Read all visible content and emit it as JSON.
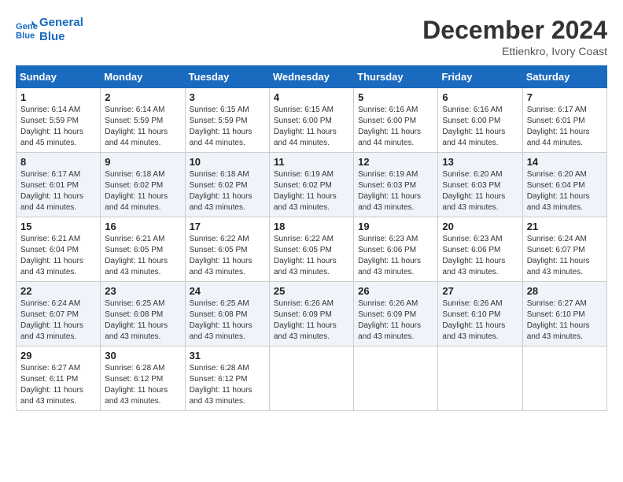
{
  "header": {
    "logo_line1": "General",
    "logo_line2": "Blue",
    "month_title": "December 2024",
    "subtitle": "Ettienkro, Ivory Coast"
  },
  "weekdays": [
    "Sunday",
    "Monday",
    "Tuesday",
    "Wednesday",
    "Thursday",
    "Friday",
    "Saturday"
  ],
  "weeks": [
    [
      {
        "day": "1",
        "sunrise": "6:14 AM",
        "sunset": "5:59 PM",
        "daylight": "11 hours and 45 minutes."
      },
      {
        "day": "2",
        "sunrise": "6:14 AM",
        "sunset": "5:59 PM",
        "daylight": "11 hours and 44 minutes."
      },
      {
        "day": "3",
        "sunrise": "6:15 AM",
        "sunset": "5:59 PM",
        "daylight": "11 hours and 44 minutes."
      },
      {
        "day": "4",
        "sunrise": "6:15 AM",
        "sunset": "6:00 PM",
        "daylight": "11 hours and 44 minutes."
      },
      {
        "day": "5",
        "sunrise": "6:16 AM",
        "sunset": "6:00 PM",
        "daylight": "11 hours and 44 minutes."
      },
      {
        "day": "6",
        "sunrise": "6:16 AM",
        "sunset": "6:00 PM",
        "daylight": "11 hours and 44 minutes."
      },
      {
        "day": "7",
        "sunrise": "6:17 AM",
        "sunset": "6:01 PM",
        "daylight": "11 hours and 44 minutes."
      }
    ],
    [
      {
        "day": "8",
        "sunrise": "6:17 AM",
        "sunset": "6:01 PM",
        "daylight": "11 hours and 44 minutes."
      },
      {
        "day": "9",
        "sunrise": "6:18 AM",
        "sunset": "6:02 PM",
        "daylight": "11 hours and 44 minutes."
      },
      {
        "day": "10",
        "sunrise": "6:18 AM",
        "sunset": "6:02 PM",
        "daylight": "11 hours and 43 minutes."
      },
      {
        "day": "11",
        "sunrise": "6:19 AM",
        "sunset": "6:02 PM",
        "daylight": "11 hours and 43 minutes."
      },
      {
        "day": "12",
        "sunrise": "6:19 AM",
        "sunset": "6:03 PM",
        "daylight": "11 hours and 43 minutes."
      },
      {
        "day": "13",
        "sunrise": "6:20 AM",
        "sunset": "6:03 PM",
        "daylight": "11 hours and 43 minutes."
      },
      {
        "day": "14",
        "sunrise": "6:20 AM",
        "sunset": "6:04 PM",
        "daylight": "11 hours and 43 minutes."
      }
    ],
    [
      {
        "day": "15",
        "sunrise": "6:21 AM",
        "sunset": "6:04 PM",
        "daylight": "11 hours and 43 minutes."
      },
      {
        "day": "16",
        "sunrise": "6:21 AM",
        "sunset": "6:05 PM",
        "daylight": "11 hours and 43 minutes."
      },
      {
        "day": "17",
        "sunrise": "6:22 AM",
        "sunset": "6:05 PM",
        "daylight": "11 hours and 43 minutes."
      },
      {
        "day": "18",
        "sunrise": "6:22 AM",
        "sunset": "6:05 PM",
        "daylight": "11 hours and 43 minutes."
      },
      {
        "day": "19",
        "sunrise": "6:23 AM",
        "sunset": "6:06 PM",
        "daylight": "11 hours and 43 minutes."
      },
      {
        "day": "20",
        "sunrise": "6:23 AM",
        "sunset": "6:06 PM",
        "daylight": "11 hours and 43 minutes."
      },
      {
        "day": "21",
        "sunrise": "6:24 AM",
        "sunset": "6:07 PM",
        "daylight": "11 hours and 43 minutes."
      }
    ],
    [
      {
        "day": "22",
        "sunrise": "6:24 AM",
        "sunset": "6:07 PM",
        "daylight": "11 hours and 43 minutes."
      },
      {
        "day": "23",
        "sunrise": "6:25 AM",
        "sunset": "6:08 PM",
        "daylight": "11 hours and 43 minutes."
      },
      {
        "day": "24",
        "sunrise": "6:25 AM",
        "sunset": "6:08 PM",
        "daylight": "11 hours and 43 minutes."
      },
      {
        "day": "25",
        "sunrise": "6:26 AM",
        "sunset": "6:09 PM",
        "daylight": "11 hours and 43 minutes."
      },
      {
        "day": "26",
        "sunrise": "6:26 AM",
        "sunset": "6:09 PM",
        "daylight": "11 hours and 43 minutes."
      },
      {
        "day": "27",
        "sunrise": "6:26 AM",
        "sunset": "6:10 PM",
        "daylight": "11 hours and 43 minutes."
      },
      {
        "day": "28",
        "sunrise": "6:27 AM",
        "sunset": "6:10 PM",
        "daylight": "11 hours and 43 minutes."
      }
    ],
    [
      {
        "day": "29",
        "sunrise": "6:27 AM",
        "sunset": "6:11 PM",
        "daylight": "11 hours and 43 minutes."
      },
      {
        "day": "30",
        "sunrise": "6:28 AM",
        "sunset": "6:12 PM",
        "daylight": "11 hours and 43 minutes."
      },
      {
        "day": "31",
        "sunrise": "6:28 AM",
        "sunset": "6:12 PM",
        "daylight": "11 hours and 43 minutes."
      },
      null,
      null,
      null,
      null
    ]
  ]
}
